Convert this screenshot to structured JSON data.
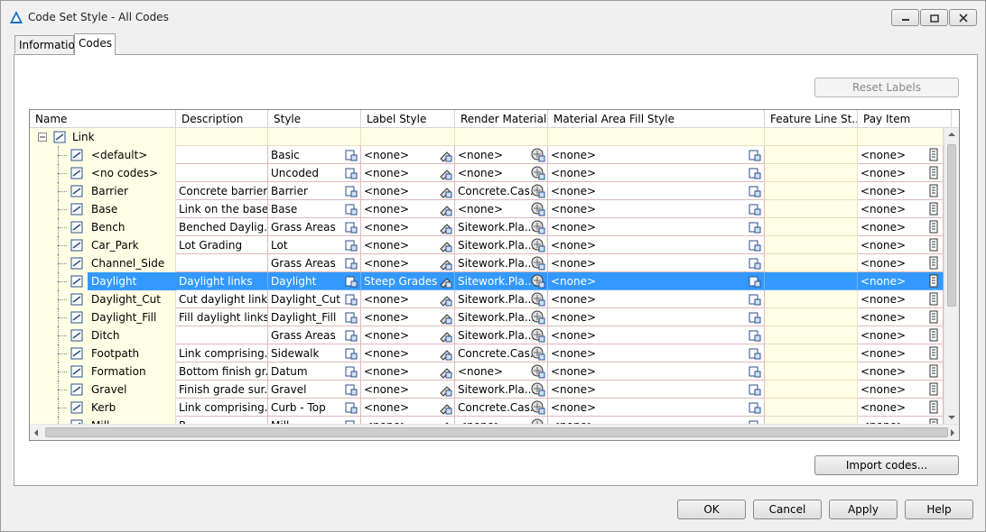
{
  "window": {
    "title": "Code Set Style - All Codes",
    "controls": [
      "minimize-icon",
      "restore-icon",
      "close-icon"
    ]
  },
  "tabs": [
    {
      "label": "Information",
      "active": false
    },
    {
      "label": "Codes",
      "active": true
    }
  ],
  "toolbar": {
    "reset_labels": "Reset Labels"
  },
  "columns": [
    "Name",
    "Description",
    "Style",
    "Label Style",
    "Render Material",
    "Material Area Fill Style",
    "Feature Line St...",
    "Pay Item"
  ],
  "tree_root": "Link",
  "rows": [
    {
      "name": "<default>",
      "description": "",
      "style": "Basic",
      "label_style": "<none>",
      "render_material": "<none>",
      "material_area_fill": "<none>",
      "feature_line": "",
      "pay_item": "<none>",
      "selected": false
    },
    {
      "name": "<no codes>",
      "description": "",
      "style": "Uncoded",
      "label_style": "<none>",
      "render_material": "<none>",
      "material_area_fill": "<none>",
      "feature_line": "",
      "pay_item": "<none>",
      "selected": false
    },
    {
      "name": "Barrier",
      "description": "Concrete barrier",
      "style": "Barrier",
      "label_style": "<none>",
      "render_material": "Concrete.Cas...",
      "material_area_fill": "<none>",
      "feature_line": "",
      "pay_item": "<none>",
      "selected": false
    },
    {
      "name": "Base",
      "description": "Link on the base...",
      "style": "Base",
      "label_style": "<none>",
      "render_material": "<none>",
      "material_area_fill": "<none>",
      "feature_line": "",
      "pay_item": "<none>",
      "selected": false
    },
    {
      "name": "Bench",
      "description": "Benched Daylig...",
      "style": "Grass Areas",
      "label_style": "<none>",
      "render_material": "Sitework.Pla...",
      "material_area_fill": "<none>",
      "feature_line": "",
      "pay_item": "<none>",
      "selected": false
    },
    {
      "name": "Car_Park",
      "description": "Lot Grading",
      "style": "Lot",
      "label_style": "<none>",
      "render_material": "Sitework.Pla...",
      "material_area_fill": "<none>",
      "feature_line": "",
      "pay_item": "<none>",
      "selected": false
    },
    {
      "name": "Channel_Side",
      "description": "",
      "style": "Grass Areas",
      "label_style": "<none>",
      "render_material": "Sitework.Pla...",
      "material_area_fill": "<none>",
      "feature_line": "",
      "pay_item": "<none>",
      "selected": false
    },
    {
      "name": "Daylight",
      "description": "Daylight links",
      "style": "Daylight",
      "label_style": "Steep Grades",
      "render_material": "Sitework.Pla...",
      "material_area_fill": "<none>",
      "feature_line": "",
      "pay_item": "<none>",
      "selected": true
    },
    {
      "name": "Daylight_Cut",
      "description": "Cut daylight links",
      "style": "Daylight_Cut",
      "label_style": "<none>",
      "render_material": "Sitework.Pla...",
      "material_area_fill": "<none>",
      "feature_line": "",
      "pay_item": "<none>",
      "selected": false
    },
    {
      "name": "Daylight_Fill",
      "description": "Fill daylight links",
      "style": "Daylight_Fill",
      "label_style": "<none>",
      "render_material": "Sitework.Pla...",
      "material_area_fill": "<none>",
      "feature_line": "",
      "pay_item": "<none>",
      "selected": false
    },
    {
      "name": "Ditch",
      "description": "",
      "style": "Grass Areas",
      "label_style": "<none>",
      "render_material": "Sitework.Pla...",
      "material_area_fill": "<none>",
      "feature_line": "",
      "pay_item": "<none>",
      "selected": false
    },
    {
      "name": "Footpath",
      "description": "Link comprising...",
      "style": "Sidewalk",
      "label_style": "<none>",
      "render_material": "Concrete.Cas...",
      "material_area_fill": "<none>",
      "feature_line": "",
      "pay_item": "<none>",
      "selected": false
    },
    {
      "name": "Formation",
      "description": "Bottom finish gr...",
      "style": "Datum",
      "label_style": "<none>",
      "render_material": "<none>",
      "material_area_fill": "<none>",
      "feature_line": "",
      "pay_item": "<none>",
      "selected": false
    },
    {
      "name": "Gravel",
      "description": "Finish grade sur...",
      "style": "Gravel",
      "label_style": "<none>",
      "render_material": "Sitework.Pla...",
      "material_area_fill": "<none>",
      "feature_line": "",
      "pay_item": "<none>",
      "selected": false
    },
    {
      "name": "Kerb",
      "description": "Link comprising...",
      "style": "Curb - Top",
      "label_style": "<none>",
      "render_material": "Concrete.Cas...",
      "material_area_fill": "<none>",
      "feature_line": "",
      "pay_item": "<none>",
      "selected": false
    },
    {
      "name": "Mill",
      "description": "R...",
      "style": "Mill",
      "label_style": "<none>",
      "render_material": "<none>",
      "material_area_fill": "<none>",
      "feature_line": "",
      "pay_item": "<none>",
      "selected": false
    }
  ],
  "import_codes": "Import codes...",
  "footer": {
    "ok": "OK",
    "cancel": "Cancel",
    "apply": "Apply",
    "help": "Help"
  },
  "colors": {
    "selection": "#3399ff",
    "yellow_cell": "#ffffe6",
    "grid_line": "#e0b8b8"
  }
}
